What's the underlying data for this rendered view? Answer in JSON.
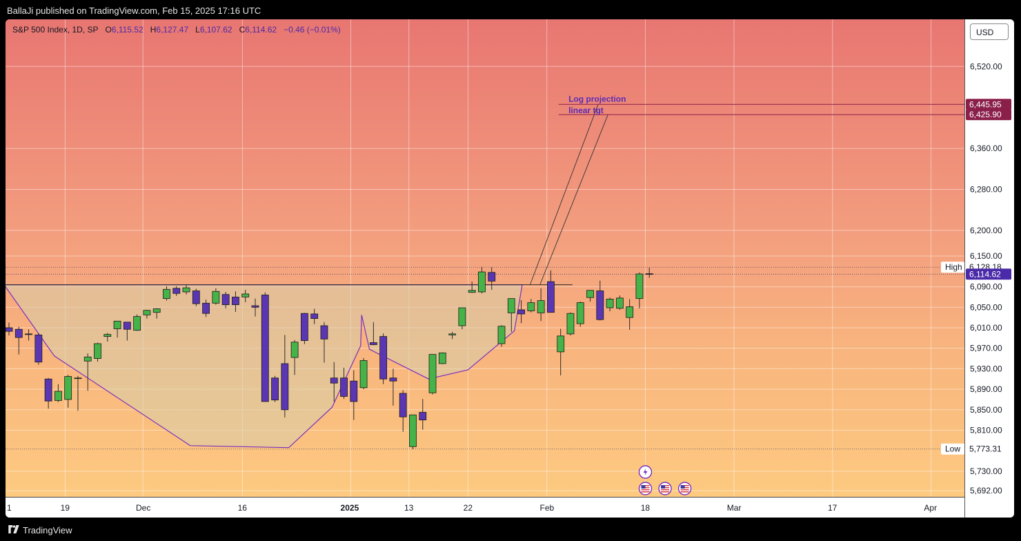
{
  "header": {
    "publisher_line": "BallaJi published on TradingView.com, Feb 15, 2025 17:16 UTC"
  },
  "legend": {
    "symbol": "S&P 500 Index, 1D, SP",
    "o_label": "O",
    "o_value": "6,115.52",
    "h_label": "H",
    "h_value": "6,127.47",
    "l_label": "L",
    "l_value": "6,107.62",
    "c_label": "C",
    "c_value": "6,114.62",
    "change": "−0.46 (−0.01%)"
  },
  "currency_button": "USD",
  "footer": {
    "brand": "TradingView"
  },
  "chart_data": {
    "type": "candlestick",
    "y_axis": {
      "ylim": [
        5680,
        6612
      ],
      "ticks": [
        "6,520.00",
        "6,360.00",
        "6,280.00",
        "6,200.00",
        "6,150.00",
        "6,090.00",
        "6,050.00",
        "6,010.00",
        "5,970.00",
        "5,930.00",
        "5,890.00",
        "5,850.00",
        "5,810.00",
        "5,730.00",
        "5,692.00"
      ]
    },
    "x_axis": {
      "ticks": [
        {
          "label": "1",
          "bold": false,
          "x_index": -0.5
        },
        {
          "label": "19",
          "bold": false,
          "x_index": 5.7
        },
        {
          "label": "Dec",
          "bold": false,
          "x_index": 13.6
        },
        {
          "label": "16",
          "bold": false,
          "x_index": 23.7
        },
        {
          "label": "2025",
          "bold": true,
          "x_index": 34.7
        },
        {
          "label": "13",
          "bold": false,
          "x_index": 40.6
        },
        {
          "label": "22",
          "bold": false,
          "x_index": 46.6
        },
        {
          "label": "Feb",
          "bold": false,
          "x_index": 54.6
        },
        {
          "label": "18",
          "bold": false,
          "x_index": 64.6
        },
        {
          "label": "Mar",
          "bold": false,
          "x_index": 73.6
        },
        {
          "label": "17",
          "bold": false,
          "x_index": 83.6
        },
        {
          "label": "Apr",
          "bold": false,
          "x_index": 93.6
        }
      ]
    },
    "candles": [
      {
        "o": 6010,
        "h": 6020,
        "l": 5995,
        "c": 6003
      },
      {
        "o": 6007,
        "h": 6012,
        "l": 5958,
        "c": 5991
      },
      {
        "o": 5998,
        "h": 6007,
        "l": 5985,
        "c": 5997
      },
      {
        "o": 5996,
        "h": 5999,
        "l": 5938,
        "c": 5943
      },
      {
        "o": 5910,
        "h": 5912,
        "l": 5852,
        "c": 5867
      },
      {
        "o": 5868,
        "h": 5900,
        "l": 5865,
        "c": 5886
      },
      {
        "o": 5870,
        "h": 5918,
        "l": 5854,
        "c": 5915
      },
      {
        "o": 5911,
        "h": 5916,
        "l": 5848,
        "c": 5912
      },
      {
        "o": 5945,
        "h": 5960,
        "l": 5887,
        "c": 5953
      },
      {
        "o": 5950,
        "h": 5981,
        "l": 5944,
        "c": 5979
      },
      {
        "o": 5993,
        "h": 6000,
        "l": 5983,
        "c": 5997
      },
      {
        "o": 6008,
        "h": 6021,
        "l": 5991,
        "c": 6023
      },
      {
        "o": 6021,
        "h": 6021,
        "l": 5985,
        "c": 6007
      },
      {
        "o": 6005,
        "h": 6036,
        "l": 6004,
        "c": 6032
      },
      {
        "o": 6035,
        "h": 6045,
        "l": 6028,
        "c": 6044
      },
      {
        "o": 6040,
        "h": 6048,
        "l": 6028,
        "c": 6047
      },
      {
        "o": 6067,
        "h": 6091,
        "l": 6063,
        "c": 6085
      },
      {
        "o": 6087,
        "h": 6091,
        "l": 6072,
        "c": 6077
      },
      {
        "o": 6080,
        "h": 6093,
        "l": 6075,
        "c": 6088
      },
      {
        "o": 6082,
        "h": 6086,
        "l": 6052,
        "c": 6057
      },
      {
        "o": 6058,
        "h": 6065,
        "l": 6031,
        "c": 6038
      },
      {
        "o": 6058,
        "h": 6087,
        "l": 6055,
        "c": 6081
      },
      {
        "o": 6075,
        "h": 6080,
        "l": 6048,
        "c": 6055
      },
      {
        "o": 6070,
        "h": 6081,
        "l": 6041,
        "c": 6055
      },
      {
        "o": 6070,
        "h": 6084,
        "l": 6060,
        "c": 6076
      },
      {
        "o": 6053,
        "h": 6067,
        "l": 6032,
        "c": 6050
      },
      {
        "o": 6074,
        "h": 6079,
        "l": 6050,
        "c": 5866
      },
      {
        "o": 5912,
        "h": 5916,
        "l": 5865,
        "c": 5869
      },
      {
        "o": 5940,
        "h": 5996,
        "l": 5835,
        "c": 5850
      },
      {
        "o": 5952,
        "h": 5986,
        "l": 5918,
        "c": 5982
      },
      {
        "o": 6038,
        "h": 6039,
        "l": 5978,
        "c": 5985
      },
      {
        "o": 6037,
        "h": 6047,
        "l": 6017,
        "c": 6028
      },
      {
        "o": 6014,
        "h": 6021,
        "l": 5942,
        "c": 5988
      },
      {
        "o": 5912,
        "h": 5943,
        "l": 5866,
        "c": 5902
      },
      {
        "o": 5912,
        "h": 5932,
        "l": 5871,
        "c": 5876
      },
      {
        "o": 5906,
        "h": 5927,
        "l": 5830,
        "c": 5866
      },
      {
        "o": 5893,
        "h": 5951,
        "l": 5890,
        "c": 5946
      },
      {
        "o": 5981,
        "h": 6021,
        "l": 5976,
        "c": 5977
      },
      {
        "o": 5993,
        "h": 5999,
        "l": 5900,
        "c": 5910
      },
      {
        "o": 5912,
        "h": 5930,
        "l": 5858,
        "c": 5906
      },
      {
        "o": 5882,
        "h": 5888,
        "l": 5807,
        "c": 5836
      },
      {
        "o": 5778,
        "h": 5840,
        "l": 5773,
        "c": 5840
      },
      {
        "o": 5845,
        "h": 5871,
        "l": 5811,
        "c": 5830
      },
      {
        "o": 5883,
        "h": 5955,
        "l": 5880,
        "c": 5958
      },
      {
        "o": 5940,
        "h": 5962,
        "l": 5939,
        "c": 5961
      },
      {
        "o": 5996,
        "h": 6002,
        "l": 5988,
        "c": 5998
      },
      {
        "o": 6014,
        "h": 6048,
        "l": 6007,
        "c": 6049
      },
      {
        "o": 6079,
        "h": 6100,
        "l": 6078,
        "c": 6083
      },
      {
        "o": 6080,
        "h": 6129,
        "l": 6077,
        "c": 6119
      },
      {
        "o": 6118,
        "h": 6128,
        "l": 6084,
        "c": 6101
      },
      {
        "o": 5979,
        "h": 6015,
        "l": 5973,
        "c": 6013
      },
      {
        "o": 6039,
        "h": 6065,
        "l": 6002,
        "c": 6067
      },
      {
        "o": 6045,
        "h": 6064,
        "l": 6019,
        "c": 6037
      },
      {
        "o": 6043,
        "h": 6066,
        "l": 6040,
        "c": 6059
      },
      {
        "o": 6039,
        "h": 6087,
        "l": 6023,
        "c": 6063
      },
      {
        "o": 6100,
        "h": 6122,
        "l": 6044,
        "c": 6040
      },
      {
        "o": 5963,
        "h": 6008,
        "l": 5917,
        "c": 5994
      },
      {
        "o": 5998,
        "h": 6040,
        "l": 5995,
        "c": 6038
      },
      {
        "o": 6018,
        "h": 6061,
        "l": 6012,
        "c": 6059
      },
      {
        "o": 6069,
        "h": 6083,
        "l": 6061,
        "c": 6083
      },
      {
        "o": 6082,
        "h": 6102,
        "l": 6024,
        "c": 6026
      },
      {
        "o": 6049,
        "h": 6069,
        "l": 6042,
        "c": 6066
      },
      {
        "o": 6048,
        "h": 6073,
        "l": 6045,
        "c": 6068
      },
      {
        "o": 6030,
        "h": 6066,
        "l": 6006,
        "c": 6051
      },
      {
        "o": 6067,
        "h": 6118,
        "l": 6048,
        "c": 6115
      },
      {
        "o": 6115.52,
        "h": 6127.47,
        "l": 6107.62,
        "c": 6114.62
      }
    ],
    "lines": [
      {
        "label": "Log projection",
        "value": 6445.95,
        "badge": "6,445.95"
      },
      {
        "label": "linear tgt",
        "value": 6425.9,
        "badge": "6,425.90"
      }
    ],
    "markers": [
      {
        "label": "High",
        "value": 6128.18,
        "badge": "6,128.18"
      },
      {
        "label": "",
        "value": 6114.62,
        "badge": "6,114.62"
      },
      {
        "label": "Low",
        "value": 5773.31,
        "badge": "5,773.31"
      }
    ],
    "neckline": 6094,
    "pattern": [
      [
        -0.5,
        6094
      ],
      [
        4.6,
        5955
      ],
      [
        18.4,
        5780
      ],
      [
        28.4,
        5776
      ],
      [
        32.8,
        5855
      ],
      [
        35.7,
        5975
      ],
      [
        35.8,
        6035
      ],
      [
        36.6,
        5968
      ],
      [
        42.6,
        5910
      ],
      [
        46.6,
        5928
      ],
      [
        51.3,
        6004
      ],
      [
        52.1,
        6094
      ]
    ],
    "projection_lines": [
      [
        [
          52.9,
          6094
        ],
        [
          59.8,
          6445.95
        ]
      ],
      [
        [
          53.9,
          6094
        ],
        [
          60.8,
          6425.9
        ]
      ]
    ],
    "event_icons": [
      "lightning-icon",
      "us-flag-icon",
      "us-flag-icon",
      "us-flag-icon"
    ]
  }
}
